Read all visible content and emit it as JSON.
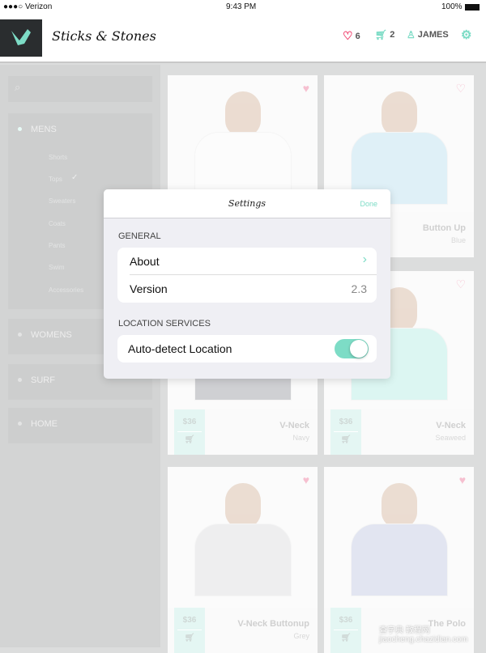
{
  "status_bar": {
    "carrier": "●●●○ Verizon",
    "time": "9:43 PM",
    "battery": "100%"
  },
  "header": {
    "brand": "Sticks & Stones",
    "favorites_count": "6",
    "cart_count": "2",
    "user": "JAMES",
    "accent": "#7ddcc6",
    "heart_color": "#f0426e"
  },
  "sidebar": {
    "search_placeholder": "",
    "categories": [
      {
        "label": "MENS",
        "subs": [
          "Shorts",
          "Tops",
          "Sweaters",
          "Coats",
          "Pants",
          "Swim",
          "Accessories"
        ],
        "selected_sub": "Tops"
      },
      {
        "label": "WOMENS"
      },
      {
        "label": "SURF"
      },
      {
        "label": "HOME"
      }
    ]
  },
  "products": [
    {
      "name": "",
      "color": "",
      "price": "",
      "favorited": true,
      "shirt": "#ffffff"
    },
    {
      "name": "Button Up",
      "color": "Blue",
      "price": "",
      "favorited": false,
      "shirt": "#bfe4f4"
    },
    {
      "name": "V-Neck",
      "color": "Navy",
      "price": "$36",
      "favorited": false,
      "shirt": "#9a9ea4"
    },
    {
      "name": "V-Neck",
      "color": "Seaweed",
      "price": "$36",
      "favorited": false,
      "shirt": "#b8f0e8"
    },
    {
      "name": "V-Neck Buttonup",
      "color": "Grey",
      "price": "$36",
      "favorited": true,
      "shirt": "#dfe0e2"
    },
    {
      "name": "The Polo",
      "color": "",
      "price": "$36",
      "favorited": true,
      "shirt": "#c4cbe6"
    }
  ],
  "settings": {
    "title": "Settings",
    "done": "Done",
    "general_header": "GENERAL",
    "about": "About",
    "version_label": "Version",
    "version_value": "2.3",
    "location_header": "LOCATION SERVICES",
    "auto_detect": "Auto-detect Location",
    "auto_detect_on": true
  },
  "watermark": "查字典 教程网 jiaocheng.chazidian.com"
}
